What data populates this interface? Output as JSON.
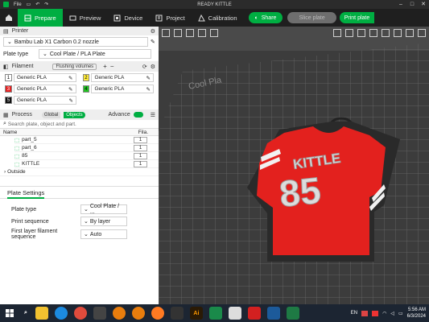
{
  "titlebar": {
    "file_label": "File",
    "title": "READY KITTLE"
  },
  "toolbar": {
    "tabs": [
      {
        "label": "Prepare"
      },
      {
        "label": "Preview"
      },
      {
        "label": "Device"
      },
      {
        "label": "Project"
      },
      {
        "label": "Calibration"
      }
    ],
    "share_label": "Share",
    "slice_label": "Slice plate",
    "print_label": "Print plate"
  },
  "printer": {
    "section_title": "Printer",
    "printer_name": "Bambu Lab X1 Carbon 0.2 nozzle",
    "plate_type_label": "Plate type",
    "plate_type_value": "Cool Plate / PLA Plate"
  },
  "filament": {
    "section_title": "Filament",
    "flushing_label": "Flushing volumes",
    "slots": [
      {
        "num": "1",
        "color": "#ffffff",
        "name": "Generic PLA"
      },
      {
        "num": "2",
        "color": "#ffeb3b",
        "name": "Generic PLA"
      },
      {
        "num": "3",
        "color": "#e52222",
        "name": "Generic PLA"
      },
      {
        "num": "4",
        "color": "#22c322",
        "name": "Generic PLA"
      },
      {
        "num": "5",
        "color": "#111111",
        "name": "Generic PLA"
      }
    ]
  },
  "process": {
    "section_title": "Process",
    "global_label": "Global",
    "objects_label": "Objects",
    "advance_label": "Advance",
    "search_placeholder": "Search plate, object and part.",
    "col_name": "Name",
    "col_fila": "Fila.",
    "rows": [
      {
        "name": "part_5",
        "fila": "1"
      },
      {
        "name": "part_6",
        "fila": "1"
      },
      {
        "name": "85",
        "fila": "1"
      },
      {
        "name": "KITTLE",
        "fila": "1"
      }
    ],
    "outside_label": "Outside"
  },
  "plate_settings": {
    "title": "Plate Settings",
    "rows": [
      {
        "label": "Plate type",
        "value": "Cool Plate / ..."
      },
      {
        "label": "Print sequence",
        "value": "By layer"
      },
      {
        "label": "First layer filament sequence",
        "value": "Auto"
      }
    ]
  },
  "model": {
    "text": "KITTLE",
    "number": "85",
    "bed_label": "Cool Pla"
  },
  "taskbar": {
    "lang": "EN",
    "time": "5:56 AM",
    "date": "6/3/2024"
  },
  "colors": {
    "accent": "#00ae42",
    "jersey": "#e3211e",
    "dark": "#1f1f1f"
  }
}
